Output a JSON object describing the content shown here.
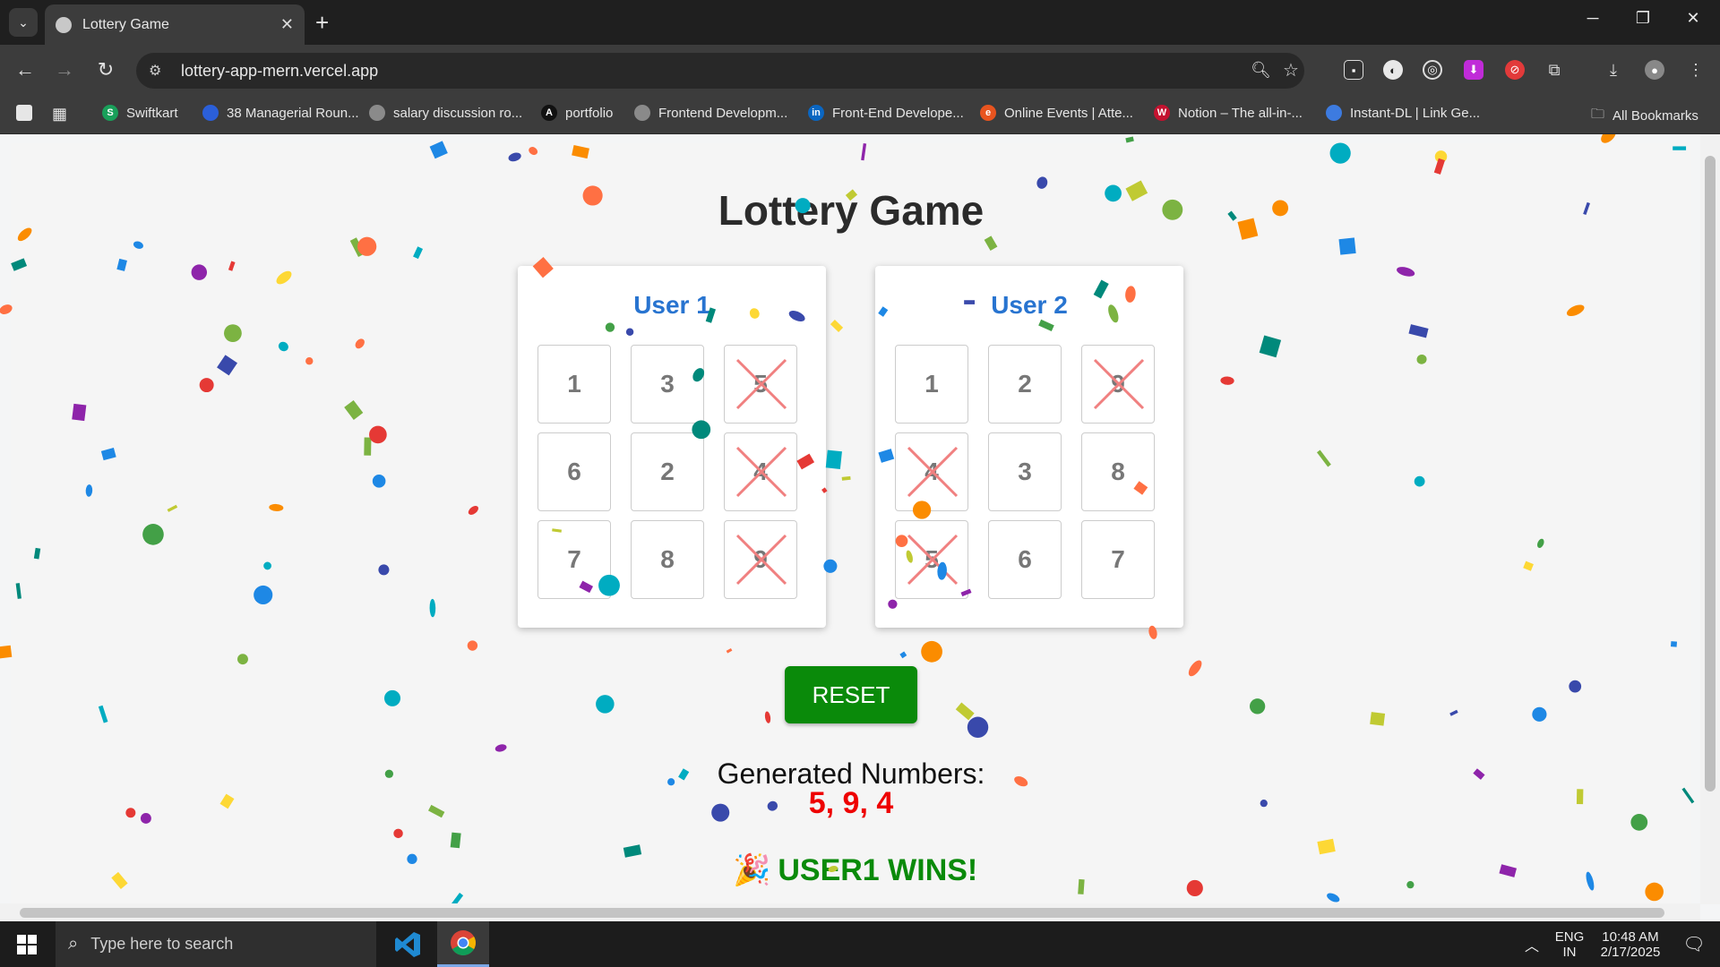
{
  "browser": {
    "tab_title": "Lottery Game",
    "url": "lottery-app-mern.vercel.app",
    "bookmarks": [
      {
        "label": "Swiftkart",
        "icon": "swiftkart-icon",
        "color": "#19a05a",
        "glyph": "S"
      },
      {
        "label": "38 Managerial Roun...",
        "icon": "bookmark-icon",
        "color": "#2b5fd9",
        "glyph": ""
      },
      {
        "label": "salary discussion ro...",
        "icon": "globe-icon",
        "color": "#8a8a8a",
        "glyph": ""
      },
      {
        "label": "portfolio",
        "icon": "portfolio-icon",
        "color": "#111111",
        "glyph": "A"
      },
      {
        "label": "Frontend Developm...",
        "icon": "globe-icon",
        "color": "#8a8a8a",
        "glyph": ""
      },
      {
        "label": "Front-End Develope...",
        "icon": "linkedin-icon",
        "color": "#0a66c2",
        "glyph": "in"
      },
      {
        "label": "Online Events | Atte...",
        "icon": "events-icon",
        "color": "#e8541f",
        "glyph": "e"
      },
      {
        "label": "Notion – The all-in-...",
        "icon": "notion-icon",
        "color": "#c4122f",
        "glyph": "W"
      },
      {
        "label": "Instant-DL | Link Ge...",
        "icon": "cloud-icon",
        "color": "#3d7be0",
        "glyph": ""
      }
    ],
    "all_bookmarks": "All Bookmarks"
  },
  "game": {
    "title": "Lottery Game",
    "users": [
      {
        "name": "User 1",
        "cells": [
          {
            "n": "1",
            "crossed": false
          },
          {
            "n": "3",
            "crossed": false
          },
          {
            "n": "5",
            "crossed": true
          },
          {
            "n": "6",
            "crossed": false
          },
          {
            "n": "2",
            "crossed": false
          },
          {
            "n": "4",
            "crossed": true
          },
          {
            "n": "7",
            "crossed": false
          },
          {
            "n": "8",
            "crossed": false
          },
          {
            "n": "9",
            "crossed": true
          }
        ]
      },
      {
        "name": "User 2",
        "cells": [
          {
            "n": "1",
            "crossed": false
          },
          {
            "n": "2",
            "crossed": false
          },
          {
            "n": "9",
            "crossed": true
          },
          {
            "n": "4",
            "crossed": true
          },
          {
            "n": "3",
            "crossed": false
          },
          {
            "n": "8",
            "crossed": false
          },
          {
            "n": "5",
            "crossed": true
          },
          {
            "n": "6",
            "crossed": false
          },
          {
            "n": "7",
            "crossed": false
          }
        ]
      }
    ],
    "reset_label": "RESET",
    "generated_label": "Generated Numbers:",
    "generated_numbers": "5, 9, 4",
    "winner_text": "USER1 WINS!",
    "accent_green": "#0a8a0a",
    "user_title_color": "#2874d0",
    "numbers_color": "#e00000"
  },
  "taskbar": {
    "search_placeholder": "Type here to search",
    "lang_top": "ENG",
    "lang_bottom": "IN",
    "time": "10:48 AM",
    "date": "2/17/2025"
  }
}
